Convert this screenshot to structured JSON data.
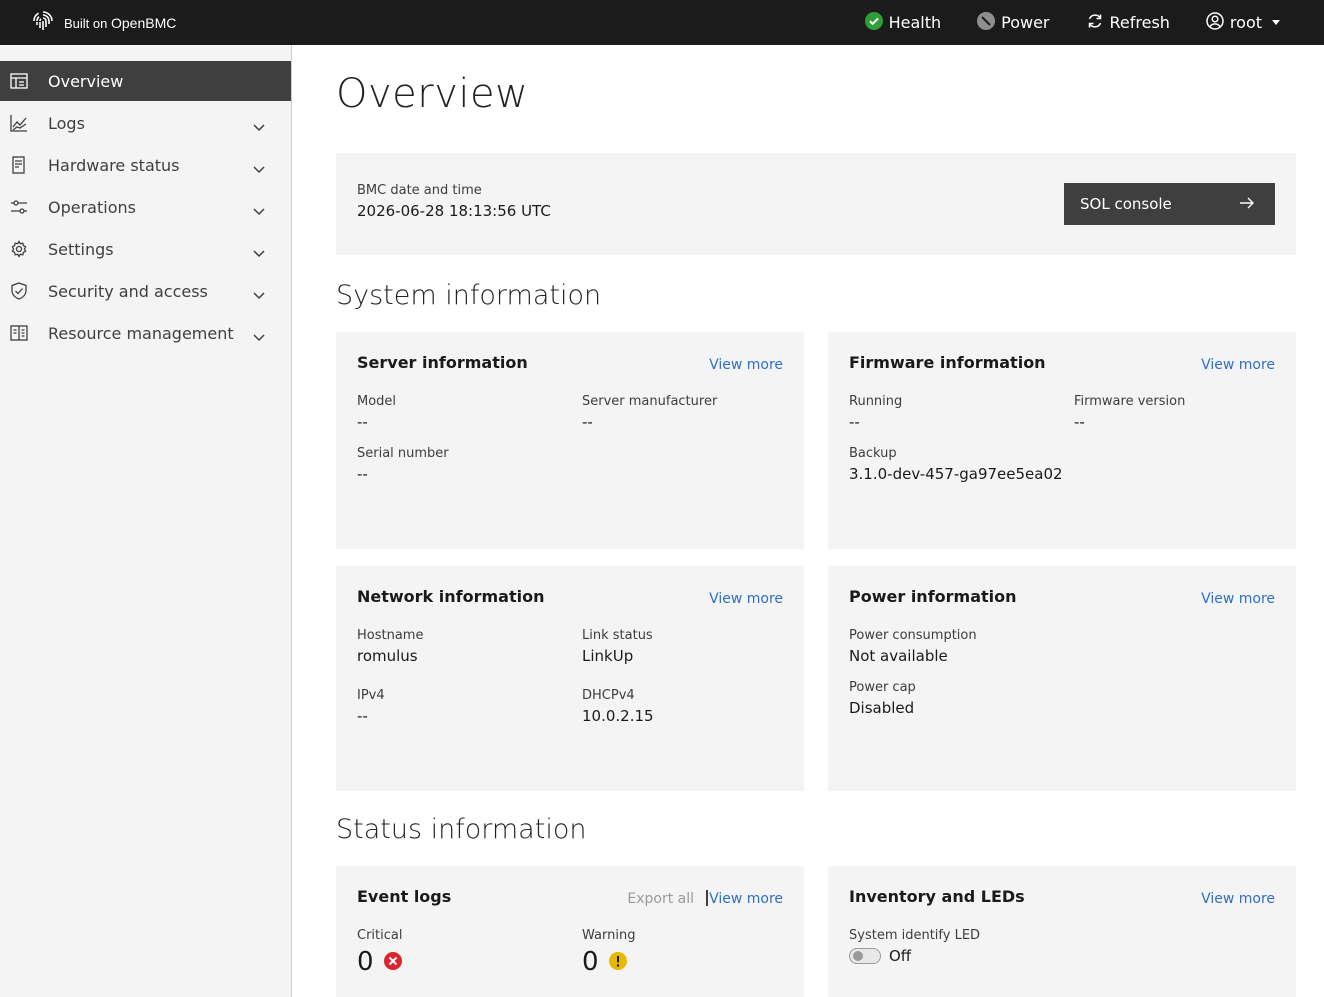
{
  "header": {
    "brand_prefix": "Built on ",
    "brand_name": "OpenBMC",
    "health": "Health",
    "power": "Power",
    "refresh": "Refresh",
    "user": "root"
  },
  "sidebar": {
    "items": [
      {
        "label": "Overview"
      },
      {
        "label": "Logs"
      },
      {
        "label": "Hardware status"
      },
      {
        "label": "Operations"
      },
      {
        "label": "Settings"
      },
      {
        "label": "Security and access"
      },
      {
        "label": "Resource management"
      }
    ]
  },
  "main": {
    "title": "Overview",
    "bmc": {
      "label": "BMC date and time",
      "value": "2026-06-28 18:13:56 UTC",
      "sol_button": "SOL console"
    },
    "system_title": "System information",
    "server": {
      "title": "Server information",
      "view_more": "View more",
      "model_label": "Model",
      "model_value": "--",
      "manufacturer_label": "Server manufacturer",
      "manufacturer_value": "--",
      "serial_label": "Serial number",
      "serial_value": "--"
    },
    "firmware": {
      "title": "Firmware information",
      "view_more": "View more",
      "running_label": "Running",
      "running_value": "--",
      "version_label": "Firmware version",
      "version_value": "--",
      "backup_label": "Backup",
      "backup_value": "3.1.0-dev-457-ga97ee5ea02"
    },
    "network": {
      "title": "Network information",
      "view_more": "View more",
      "hostname_label": "Hostname",
      "hostname_value": "romulus",
      "link_label": "Link status",
      "link_value": "LinkUp",
      "ipv4_label": "IPv4",
      "ipv4_value": "--",
      "dhcp_label": "DHCPv4",
      "dhcp_value": "10.0.2.15"
    },
    "power": {
      "title": "Power information",
      "view_more": "View more",
      "consumption_label": "Power consumption",
      "consumption_value": "Not available",
      "cap_label": "Power cap",
      "cap_value": "Disabled"
    },
    "status_title": "Status information",
    "events": {
      "title": "Event logs",
      "export": "Export all",
      "view_more": "View more",
      "critical_label": "Critical",
      "critical_value": "0",
      "warning_label": "Warning",
      "warning_value": "0"
    },
    "inventory": {
      "title": "Inventory and LEDs",
      "view_more": "View more",
      "led_label": "System identify LED",
      "led_value": "Off"
    }
  },
  "colors": {
    "health_ok": "#2e9e3a",
    "critical": "#d9262c",
    "warning": "#e8b800",
    "link": "#2f6fc7"
  }
}
